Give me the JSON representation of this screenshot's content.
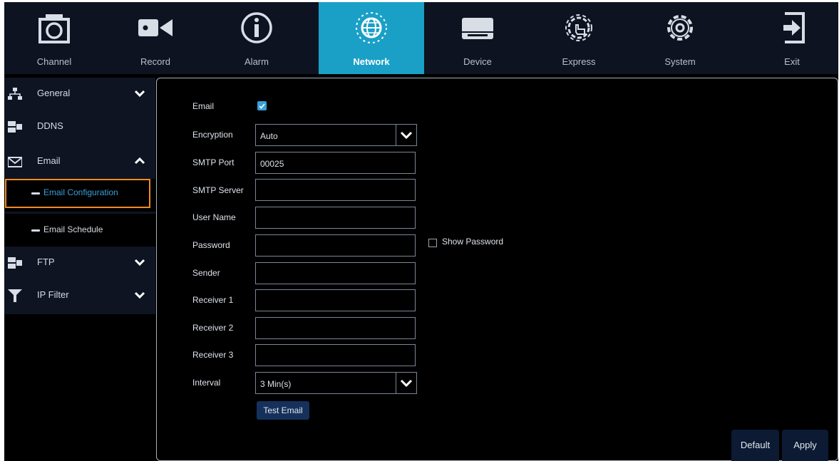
{
  "top_nav": {
    "tabs": [
      {
        "label": "Channel",
        "icon": "camera-icon"
      },
      {
        "label": "Record",
        "icon": "video-camera-icon"
      },
      {
        "label": "Alarm",
        "icon": "info-icon"
      },
      {
        "label": "Network",
        "icon": "globe-icon",
        "active": true
      },
      {
        "label": "Device",
        "icon": "hard-drive-icon"
      },
      {
        "label": "Express",
        "icon": "gear-hand-icon"
      },
      {
        "label": "System",
        "icon": "gear-icon"
      },
      {
        "label": "Exit",
        "icon": "exit-icon"
      }
    ]
  },
  "sidebar": {
    "items": [
      {
        "label": "General",
        "icon": "network-icon",
        "chevron": "down"
      },
      {
        "label": "DDNS",
        "icon": "ddns-icon"
      },
      {
        "label": "Email",
        "icon": "envelope-icon",
        "chevron": "up"
      },
      {
        "label": "FTP",
        "icon": "ftp-icon",
        "chevron": "down"
      },
      {
        "label": "IP Filter",
        "icon": "filter-icon",
        "chevron": "down"
      }
    ],
    "email_subitems": [
      {
        "label": "Email Configuration",
        "selected": true
      },
      {
        "label": "Email Schedule"
      }
    ]
  },
  "form": {
    "email_label": "Email",
    "email_checked": true,
    "encryption_label": "Encryption",
    "encryption_value": "Auto",
    "smtp_port_label": "SMTP Port",
    "smtp_port_value": "00025",
    "smtp_server_label": "SMTP Server",
    "smtp_server_value": "",
    "user_name_label": "User Name",
    "user_name_value": "",
    "password_label": "Password",
    "password_value": "",
    "show_password_label": "Show Password",
    "sender_label": "Sender",
    "sender_value": "",
    "receiver1_label": "Receiver 1",
    "receiver1_value": "",
    "receiver2_label": "Receiver 2",
    "receiver2_value": "",
    "receiver3_label": "Receiver 3",
    "receiver3_value": "",
    "interval_label": "Interval",
    "interval_value": "3 Min(s)",
    "test_email_label": "Test Email"
  },
  "footer": {
    "default_label": "Default",
    "apply_label": "Apply"
  },
  "colors": {
    "accent": "#1aa0c7",
    "checkbox": "#3a9ed8",
    "highlight": "#f08a24",
    "nav_bg": "#0d1320"
  }
}
